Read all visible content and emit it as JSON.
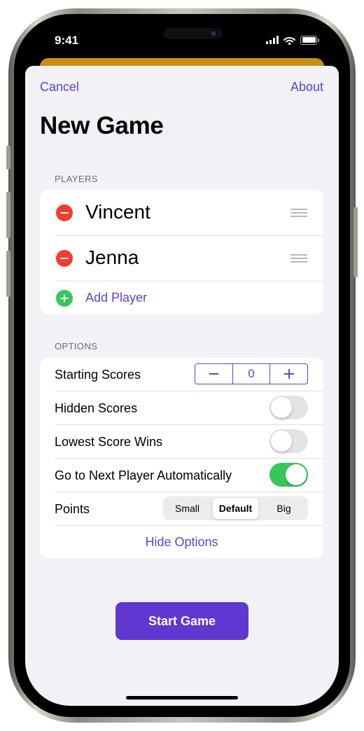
{
  "status_bar": {
    "time": "9:41"
  },
  "nav": {
    "cancel_label": "Cancel",
    "about_label": "About"
  },
  "title": "New Game",
  "players_section": {
    "header": "PLAYERS",
    "players": [
      {
        "name": "Vincent"
      },
      {
        "name": "Jenna"
      }
    ],
    "add_label": "Add Player"
  },
  "options_section": {
    "header": "OPTIONS",
    "starting_scores": {
      "label": "Starting Scores",
      "value": "0"
    },
    "hidden_scores": {
      "label": "Hidden Scores",
      "on": false
    },
    "lowest_score_wins": {
      "label": "Lowest Score Wins",
      "on": false
    },
    "next_player_auto": {
      "label": "Go to Next Player Automatically",
      "on": true
    },
    "points": {
      "label": "Points",
      "options": [
        "Small",
        "Default",
        "Big"
      ],
      "selected": "Default"
    },
    "hide_label": "Hide Options"
  },
  "start_button_label": "Start Game",
  "colors": {
    "accent": "#6044d1",
    "start_button": "#5e38d0",
    "delete": "#f23c30",
    "add": "#34c759",
    "toggle_on": "#34c759",
    "background_card": "#c7900f",
    "sheet_background": "#f2f1f6"
  },
  "icons": {
    "delete": "minus-circle-icon",
    "add": "plus-circle-icon",
    "reorder": "drag-handle-icon",
    "signal": "cellular-signal-icon",
    "wifi": "wifi-icon",
    "battery": "battery-icon"
  }
}
